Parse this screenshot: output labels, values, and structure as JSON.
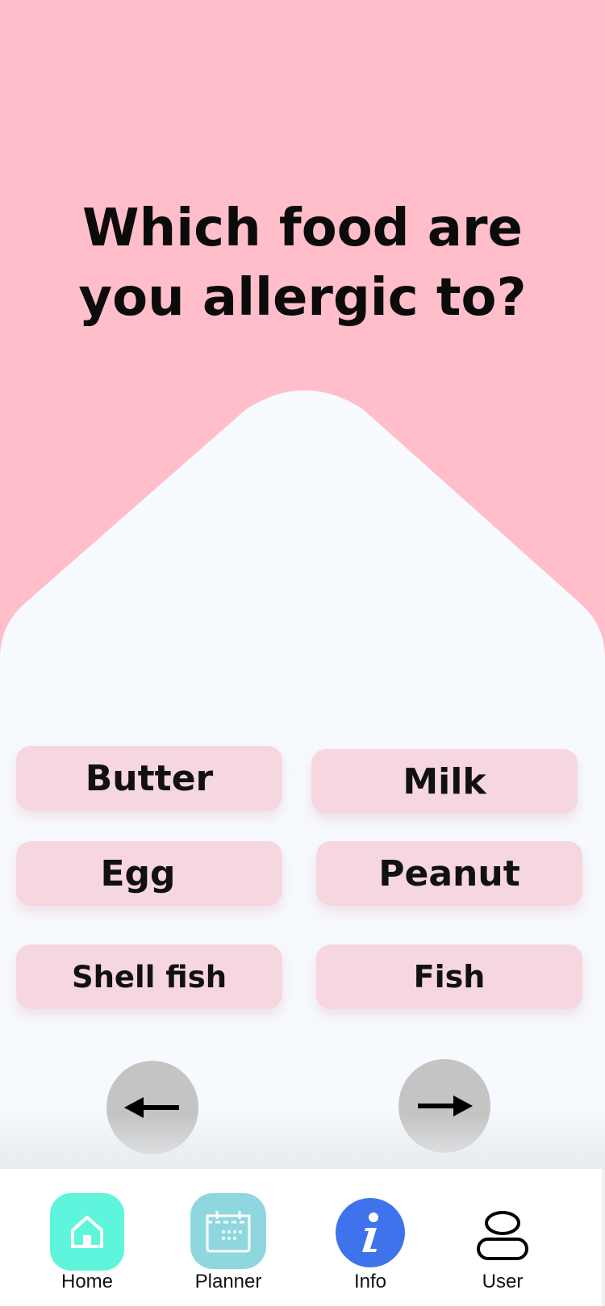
{
  "question": {
    "line1": "Which food are",
    "line2": "you allergic to?"
  },
  "options": [
    {
      "label": "Butter"
    },
    {
      "label": "Milk"
    },
    {
      "label": "Egg"
    },
    {
      "label": "Peanut"
    },
    {
      "label": "Shell fish"
    },
    {
      "label": "Fish"
    }
  ],
  "navigation": {
    "back_icon": "arrow-left-icon",
    "next_icon": "arrow-right-icon"
  },
  "tabbar": {
    "items": [
      {
        "label": "Home",
        "icon": "home-icon",
        "color": "#5ff5dc"
      },
      {
        "label": "Planner",
        "icon": "calendar-icon",
        "color": "#8fd7df"
      },
      {
        "label": "Info",
        "icon": "info-icon",
        "color": "#3f73ec"
      },
      {
        "label": "User",
        "icon": "user-icon",
        "color": "#000000"
      }
    ]
  },
  "colors": {
    "header_pink": "#ffbec9",
    "panel": "#f7faff",
    "chip": "#f6d7df",
    "nav_button": "#c4c4c4"
  }
}
